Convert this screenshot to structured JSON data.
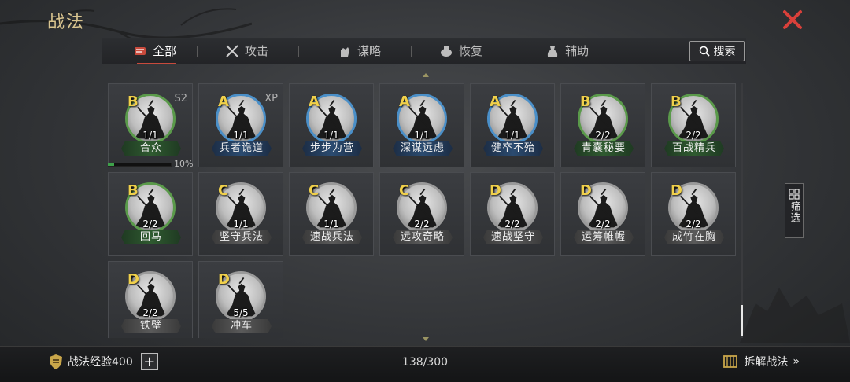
{
  "header": {
    "title": "战法"
  },
  "tabs": [
    {
      "label": "全部",
      "icon": "scroll-icon",
      "active": true
    },
    {
      "label": "攻击",
      "icon": "crossed-swords-icon",
      "active": false
    },
    {
      "label": "谋略",
      "icon": "hand-icon",
      "active": false
    },
    {
      "label": "恢复",
      "icon": "medicine-pot-icon",
      "active": false
    },
    {
      "label": "辅助",
      "icon": "bag-icon",
      "active": false
    }
  ],
  "search": {
    "label": "搜索"
  },
  "filter": {
    "label": "筛选"
  },
  "cards": [
    {
      "grade": "B",
      "tag": "S2",
      "count": "1/1",
      "name": "合众",
      "color": "green"
    },
    {
      "grade": "A",
      "tag": "XP",
      "count": "1/1",
      "name": "兵者诡道",
      "color": "blue"
    },
    {
      "grade": "A",
      "tag": "",
      "count": "1/1",
      "name": "步步为营",
      "color": "blue"
    },
    {
      "grade": "A",
      "tag": "",
      "count": "1/1",
      "name": "深谋远虑",
      "color": "blue"
    },
    {
      "grade": "A",
      "tag": "",
      "count": "1/1",
      "name": "健卒不殆",
      "color": "blue"
    },
    {
      "grade": "B",
      "tag": "",
      "count": "2/2",
      "name": "青囊秘要",
      "color": "green"
    },
    {
      "grade": "B",
      "tag": "",
      "count": "2/2",
      "name": "百战精兵",
      "color": "green"
    },
    {
      "grade": "B",
      "tag": "",
      "count": "2/2",
      "name": "回马",
      "color": "green"
    },
    {
      "grade": "C",
      "tag": "",
      "count": "1/1",
      "name": "坚守兵法",
      "color": "grey"
    },
    {
      "grade": "C",
      "tag": "",
      "count": "1/1",
      "name": "速战兵法",
      "color": "grey"
    },
    {
      "grade": "C",
      "tag": "",
      "count": "2/2",
      "name": "远攻奇略",
      "color": "grey"
    },
    {
      "grade": "D",
      "tag": "",
      "count": "2/2",
      "name": "速战坚守",
      "color": "grey"
    },
    {
      "grade": "D",
      "tag": "",
      "count": "2/2",
      "name": "运筹帷幄",
      "color": "grey"
    },
    {
      "grade": "D",
      "tag": "",
      "count": "2/2",
      "name": "成竹在胸",
      "color": "grey"
    },
    {
      "grade": "D",
      "tag": "",
      "count": "2/2",
      "name": "铁壁",
      "color": "grey"
    },
    {
      "grade": "D",
      "tag": "",
      "count": "5/5",
      "name": "冲车",
      "color": "grey"
    }
  ],
  "first_card_progress": {
    "label": "10%",
    "fraction": 0.1
  },
  "bottom": {
    "exp_label": "战法经验400",
    "plus": "+",
    "capacity": "138/300",
    "disassemble_label": "拆解战法",
    "disassemble_arrow": "»"
  },
  "colors": {
    "accent_red": "#c84a3c",
    "grade_yellow": "#f0d04a",
    "title_gold": "#d9c48f"
  }
}
